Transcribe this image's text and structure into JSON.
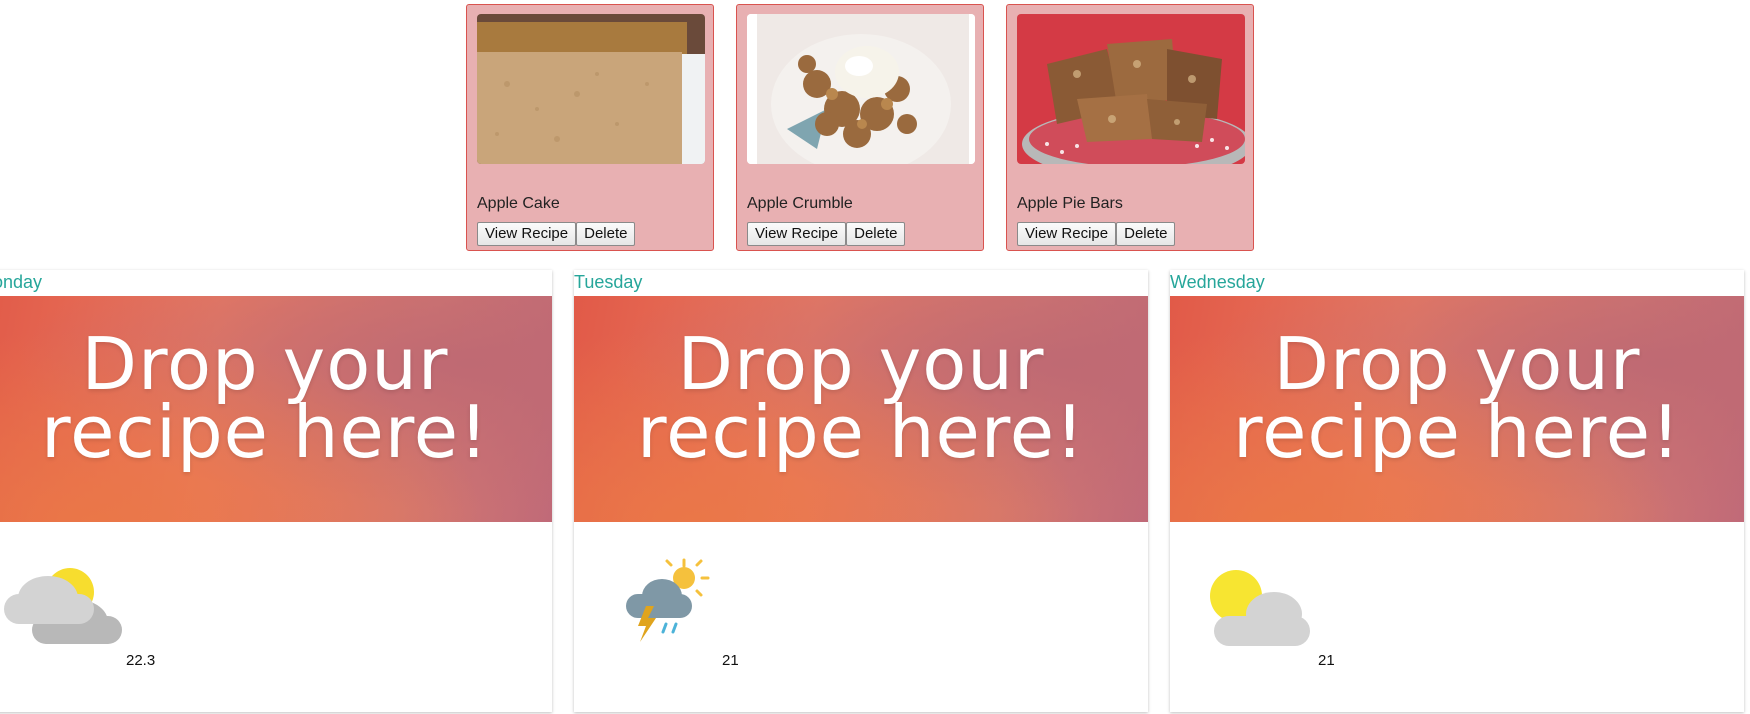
{
  "recipes": [
    {
      "title": "Apple Cake",
      "view_label": "View Recipe",
      "delete_label": "Delete"
    },
    {
      "title": "Apple Crumble",
      "view_label": "View Recipe",
      "delete_label": "Delete"
    },
    {
      "title": "Apple Pie Bars",
      "view_label": "View Recipe",
      "delete_label": "Delete"
    }
  ],
  "days": [
    {
      "name": "Monday",
      "drop_text_line1": "Drop your",
      "drop_text_line2": "recipe here!",
      "temperature": "22.3",
      "weather_icon": "partly-cloudy-icon"
    },
    {
      "name": "Tuesday",
      "drop_text_line1": "Drop your",
      "drop_text_line2": "recipe here!",
      "temperature": "21",
      "weather_icon": "thunderstorm-icon"
    },
    {
      "name": "Wednesday",
      "drop_text_line1": "Drop your",
      "drop_text_line2": "recipe here!",
      "temperature": "21",
      "weather_icon": "sun-behind-cloud-icon"
    }
  ],
  "colors": {
    "card_background": "#e8b0b2",
    "card_border": "#d9534f",
    "day_name": "#26a69a"
  }
}
